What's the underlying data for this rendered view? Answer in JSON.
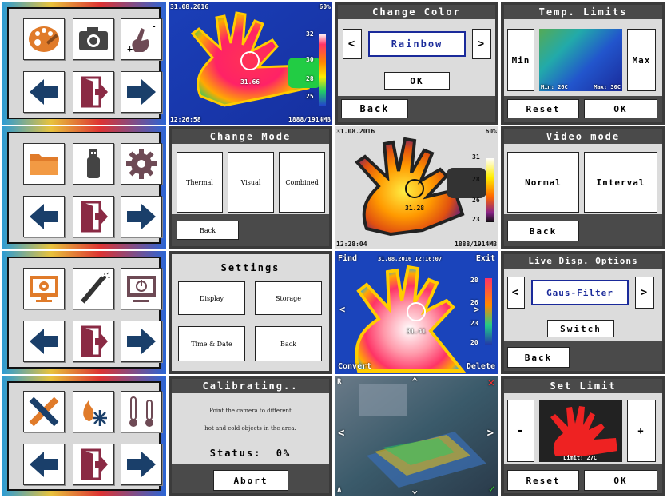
{
  "dialogs": {
    "change_color": {
      "title": "Change Color",
      "value": "Rainbow",
      "ok": "OK",
      "back": "Back",
      "prev": "<",
      "next": ">"
    },
    "temp_limits": {
      "title": "Temp. Limits",
      "min": "Min",
      "max": "Max",
      "reset": "Reset",
      "ok": "OK",
      "min_label": "Min: 26C",
      "max_label": "Max: 30C"
    },
    "change_mode": {
      "title": "Change Mode",
      "thermal": "Thermal",
      "visual": "Visual",
      "combined": "Combined",
      "back": "Back"
    },
    "video_mode": {
      "title": "Video mode",
      "normal": "Normal",
      "interval": "Interval",
      "back": "Back"
    },
    "settings": {
      "title": "Settings",
      "display": "Display",
      "storage": "Storage",
      "time_date": "Time & Date",
      "back": "Back"
    },
    "live_disp": {
      "title": "Live Disp. Options",
      "value": "Gaus-Filter",
      "switch": "Switch",
      "back": "Back",
      "prev": "<",
      "next": ">"
    },
    "calibrating": {
      "title": "Calibrating..",
      "line1": "Point the camera to different",
      "line2": "hot and cold objects in the area.",
      "status": "Status:  0%",
      "abort": "Abort"
    },
    "set_limit": {
      "title": "Set Limit",
      "minus": "-",
      "plus": "+",
      "limit": "Limit: 27C",
      "reset": "Reset",
      "ok": "OK"
    }
  },
  "thermal1": {
    "date": "31.08.2016",
    "battery": "60%",
    "time": "12:26:58",
    "storage": "1888/1914MB",
    "temp": "31.66",
    "scale": [
      "32",
      "30",
      "28",
      "25"
    ]
  },
  "thermal2": {
    "date": "31.08.2016",
    "battery": "60%",
    "time": "12:28:04",
    "storage": "1888/1914MB",
    "temp": "31.28",
    "scale": [
      "31",
      "28",
      "26",
      "23"
    ]
  },
  "thermal3": {
    "find": "Find",
    "datetime": "31.08.2016 12:16:07",
    "exit": "Exit",
    "convert": "Convert",
    "delete": "Delete",
    "temp": "31.41",
    "scale": [
      "28",
      "26",
      "23",
      "20"
    ]
  },
  "visual": {
    "r": "R",
    "a": "A"
  },
  "icons": {
    "row1": [
      "palette-icon",
      "camera-icon",
      "hand-plus-minus-icon",
      "arrow-left-icon",
      "exit-door-icon",
      "arrow-right-icon"
    ],
    "row2": [
      "folder-icon",
      "usb-icon",
      "gear-icon",
      "arrow-left-icon",
      "exit-door-icon",
      "arrow-right-icon"
    ],
    "row3": [
      "monitor-gear-icon",
      "laser-pointer-icon",
      "monitor-power-icon",
      "arrow-left-icon",
      "exit-door-icon",
      "arrow-right-icon"
    ],
    "row4": [
      "ruler-pencil-icon",
      "fire-snow-icon",
      "thermometers-icon",
      "arrow-left-icon",
      "exit-door-icon",
      "arrow-right-icon"
    ]
  },
  "colors": {
    "accent_blue": "#1a3f8a",
    "orange": "#e07b2a",
    "maroon": "#8a2a44",
    "brown": "#6e4a55"
  }
}
